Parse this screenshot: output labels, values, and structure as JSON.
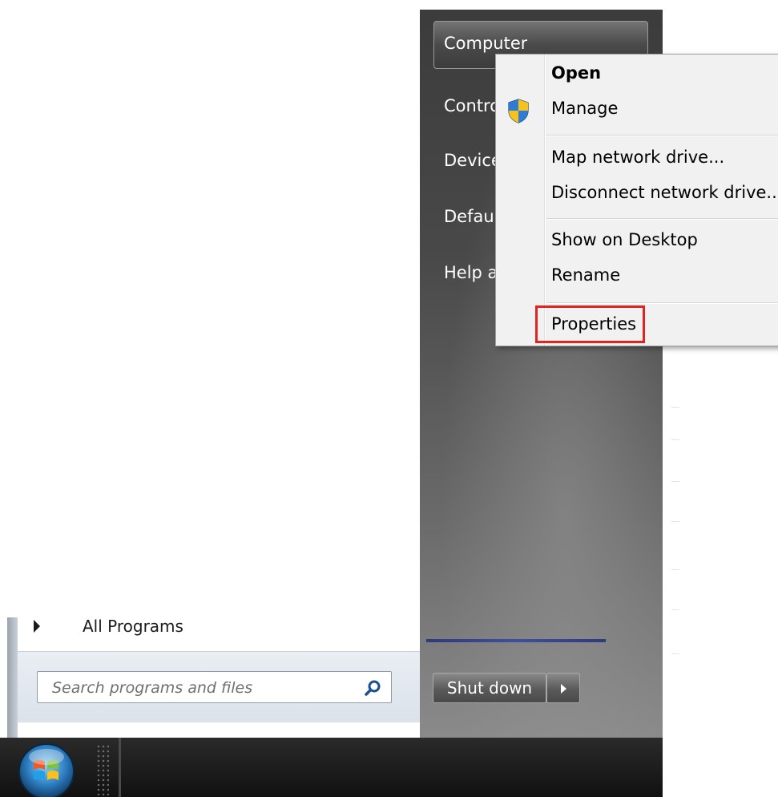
{
  "start_menu": {
    "all_programs_label": "All Programs",
    "search": {
      "placeholder": "Search programs and files",
      "value": ""
    },
    "right_pane": {
      "items": [
        {
          "label": "Computer"
        },
        {
          "label": "Contro"
        },
        {
          "label": "Device"
        },
        {
          "label": "Defau"
        },
        {
          "label": "Help a"
        }
      ],
      "shutdown_label": "Shut down"
    }
  },
  "context_menu": {
    "items": {
      "open": "Open",
      "manage": "Manage",
      "map_drive": "Map network drive...",
      "disconnect_drive": "Disconnect network drive...",
      "show_desktop": "Show on Desktop",
      "rename": "Rename",
      "properties": "Properties"
    },
    "highlighted_item": "Properties",
    "highlight_color": "#e32222"
  },
  "icons": {
    "search": "search-icon",
    "shield": "uac-shield-icon",
    "start_orb": "windows-start-orb-icon"
  }
}
